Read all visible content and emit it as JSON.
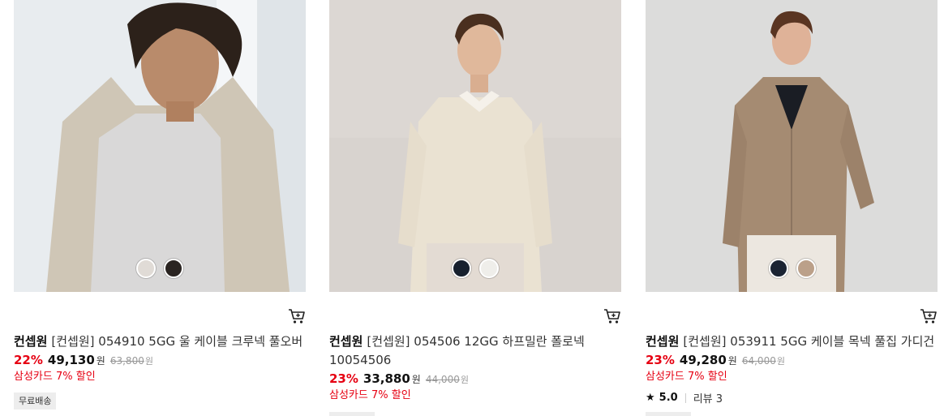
{
  "products": [
    {
      "brand": "컨셉원",
      "name": "[컨셉원] 054910 5GG 울 케이블 크루넥 풀오버",
      "discount": "22%",
      "price": "49,130",
      "currency": "원",
      "original_price": "63,800",
      "card_promo": "삼성카드 7% 할인",
      "badge": "무료배송",
      "swatches": [
        "#e0dbd6",
        "#2a2421"
      ]
    },
    {
      "brand": "컨셉원",
      "name": "[컨셉원] 054506 12GG 하프밀란 폴로넥 10054506",
      "discount": "23%",
      "price": "33,880",
      "currency": "원",
      "original_price": "44,000",
      "card_promo": "삼성카드 7% 할인",
      "swatches": [
        "#17202e",
        "#efeeea"
      ]
    },
    {
      "brand": "컨셉원",
      "name": "[컨셉원] 053911 5GG 케이블 목넥 풀집 가디건",
      "discount": "23%",
      "price": "49,280",
      "currency": "원",
      "original_price": "64,000",
      "card_promo": "삼성카드 7% 할인",
      "rating": "5.0",
      "review_label": "리뷰 3",
      "swatches": [
        "#1b2433",
        "#bba089"
      ]
    }
  ],
  "icons": {
    "cart": "cart-icon",
    "star": "star-icon"
  },
  "colors": {
    "accent_red": "#e60012",
    "badge_bg": "#ededed"
  }
}
